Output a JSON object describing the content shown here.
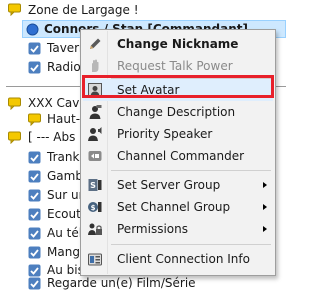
{
  "tree": {
    "channel_zone": "Zone de Largage !",
    "selected_client": "Connors / Stan [Commandant]",
    "client_tavern": "Tavern",
    "client_radio": "Radio",
    "channel_cave": "XXX Cave",
    "client_haut": "Haut-(",
    "channel_abs": "[ --- Abs",
    "client_trankil": "Trankil",
    "client_gamb": "Gamb",
    "client_sur": "Sur un",
    "client_ecoute": "Ecoute",
    "client_autel": "Au tél",
    "client_mang": "Mang",
    "client_aubis": "Au bis",
    "client_regarde": "Regarde un(e) Film/Série"
  },
  "menu": {
    "change_nickname": "Change Nickname",
    "request_talk_power": "Request Talk Power",
    "set_avatar": "Set Avatar",
    "change_description": "Change Description",
    "priority_speaker": "Priority Speaker",
    "channel_commander": "Channel Commander",
    "set_server_group": "Set Server Group",
    "set_channel_group": "Set Channel Group",
    "permissions": "Permissions",
    "client_connection_info": "Client Connection Info"
  },
  "colors": {
    "highlight_box": "#e8202a",
    "selection": "#cde8ff",
    "channel_icon": "#e8c100",
    "client_check": "#4d7fbf",
    "client_dot": "#2f6fd1"
  }
}
